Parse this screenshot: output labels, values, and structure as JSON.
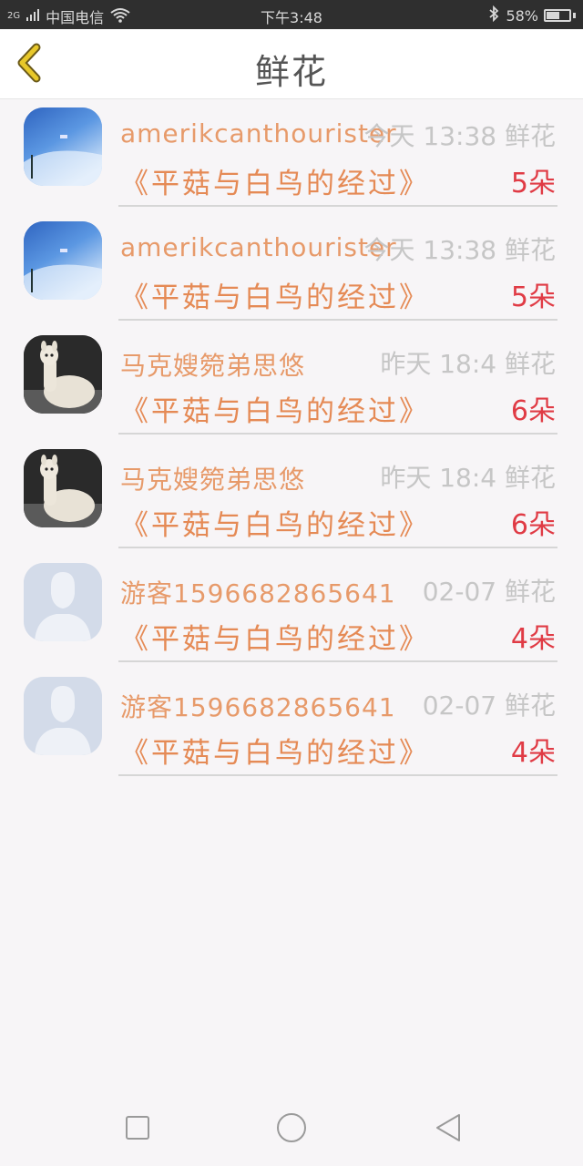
{
  "status_bar": {
    "network": "2G",
    "carrier": "中国电信",
    "time": "下午3:48",
    "battery_text": "58%",
    "battery_level": 0.58
  },
  "header": {
    "title": "鲜花",
    "back_icon": "chevron-left-icon",
    "accent_color": "#e8c82a"
  },
  "flowers": [
    {
      "name": "amerikcanthourister",
      "time": "今天 13:38 鲜花",
      "book": "《平菇与白鸟的经过》",
      "count": "5朵",
      "avatar": "sky"
    },
    {
      "name": "amerikcanthourister",
      "time": "今天 13:38 鲜花",
      "book": "《平菇与白鸟的经过》",
      "count": "5朵",
      "avatar": "sky"
    },
    {
      "name": "马克嫂箢弟思悠",
      "time": "昨天 18:4 鲜花",
      "book": "《平菇与白鸟的经过》",
      "count": "6朵",
      "avatar": "alpaca"
    },
    {
      "name": "马克嫂箢弟思悠",
      "time": "昨天 18:4 鲜花",
      "book": "《平菇与白鸟的经过》",
      "count": "6朵",
      "avatar": "alpaca"
    },
    {
      "name": "游客1596682865641",
      "time": "02-07 鲜花",
      "book": "《平菇与白鸟的经过》",
      "count": "4朵",
      "avatar": "guest"
    },
    {
      "name": "游客1596682865641",
      "time": "02-07 鲜花",
      "book": "《平菇与白鸟的经过》",
      "count": "4朵",
      "avatar": "guest"
    }
  ],
  "nav_bar": {
    "recent_icon": "square-icon",
    "home_icon": "circle-icon",
    "back_icon": "triangle-back-icon"
  }
}
